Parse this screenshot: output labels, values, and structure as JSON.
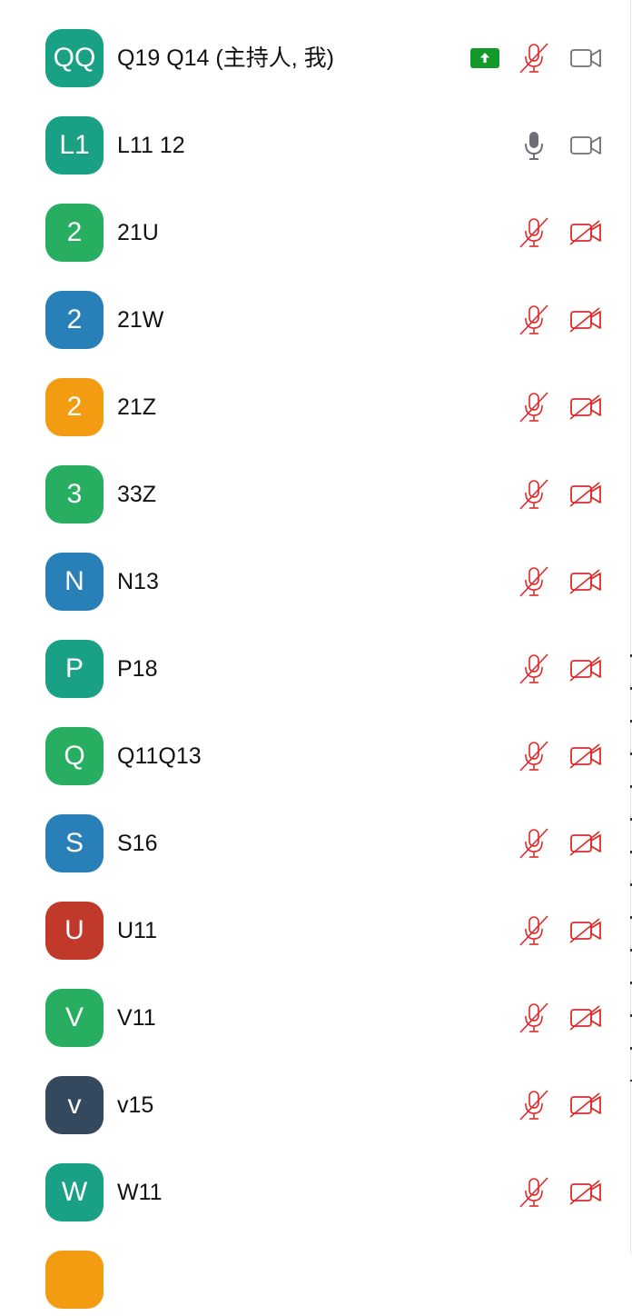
{
  "participants": [
    {
      "initials": "QQ",
      "name": "Q19 Q14 (主持人, 我)",
      "color": "#1aa085",
      "mic": "muted",
      "video": "on",
      "sharing": true
    },
    {
      "initials": "L1",
      "name": "L11 12",
      "color": "#1aa085",
      "mic": "on",
      "video": "on",
      "sharing": false
    },
    {
      "initials": "2",
      "name": "21U",
      "color": "#28ae60",
      "mic": "muted",
      "video": "off",
      "sharing": false
    },
    {
      "initials": "2",
      "name": "21W",
      "color": "#2980b9",
      "mic": "muted",
      "video": "off",
      "sharing": false
    },
    {
      "initials": "2",
      "name": "21Z",
      "color": "#f39c12",
      "mic": "muted",
      "video": "off",
      "sharing": false
    },
    {
      "initials": "3",
      "name": "33Z",
      "color": "#28ae60",
      "mic": "muted",
      "video": "off",
      "sharing": false
    },
    {
      "initials": "N",
      "name": "N13",
      "color": "#2980b9",
      "mic": "muted",
      "video": "off",
      "sharing": false
    },
    {
      "initials": "P",
      "name": "P18",
      "color": "#1aa085",
      "mic": "muted",
      "video": "off",
      "sharing": false
    },
    {
      "initials": "Q",
      "name": "Q11Q13",
      "color": "#28ae60",
      "mic": "muted",
      "video": "off",
      "sharing": false
    },
    {
      "initials": "S",
      "name": "S16",
      "color": "#2980b9",
      "mic": "muted",
      "video": "off",
      "sharing": false
    },
    {
      "initials": "U",
      "name": "U11",
      "color": "#c0392b",
      "mic": "muted",
      "video": "off",
      "sharing": false
    },
    {
      "initials": "V",
      "name": "V11",
      "color": "#28ae60",
      "mic": "muted",
      "video": "off",
      "sharing": false
    },
    {
      "initials": "v",
      "name": "v15",
      "color": "#34495e",
      "mic": "muted",
      "video": "off",
      "sharing": false
    },
    {
      "initials": "W",
      "name": "W11",
      "color": "#1aa085",
      "mic": "muted",
      "video": "off",
      "sharing": false
    },
    {
      "initials": "",
      "name": "",
      "color": "#f39c12",
      "mic": "",
      "video": "",
      "sharing": false
    }
  ],
  "icons": {
    "share": "share-screen-icon",
    "mic_on": "microphone-icon",
    "mic_muted": "microphone-muted-icon",
    "video_on": "video-camera-icon",
    "video_off": "video-camera-off-icon"
  },
  "colors": {
    "muted_red": "#e02828",
    "icon_gray": "#6e6e78",
    "share_green": "#149a2a"
  }
}
